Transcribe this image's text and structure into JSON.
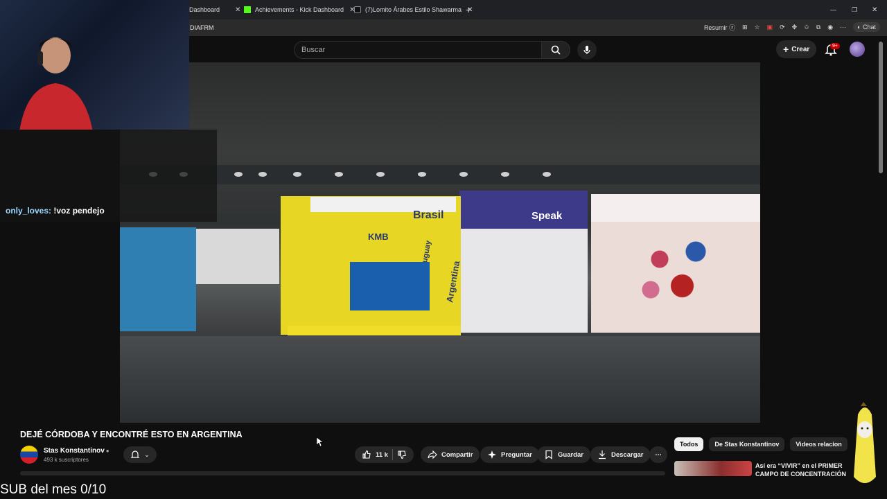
{
  "browser": {
    "tabs": [
      {
        "title": "Dashboard",
        "icon": "page-icon"
      },
      {
        "title": "Achievements - Kick Dashboard",
        "icon": "kick-icon"
      },
      {
        "title": "(7)Lomito Árabes Estilo Shawarma",
        "icon": "tiktok-icon"
      }
    ],
    "url_fragment": "DIAFRM",
    "summary_button": "Resumir",
    "chat_button": "Chat"
  },
  "youtube": {
    "search_placeholder": "Buscar",
    "create_label": "Crear",
    "notifications_badge": "9+"
  },
  "video": {
    "title": "DEJÉ CÓRDOBA Y ENCONTRÉ ESTO EN ARGENTINA",
    "channel_name": "Stas Konstantinov",
    "subscribers": "493 k suscriptores",
    "likes": "11 k",
    "actions": {
      "share": "Compartir",
      "ask": "Preguntar",
      "save": "Guardar",
      "download": "Descargar"
    },
    "scene_text": {
      "brand": "KMB",
      "country1": "Brasil",
      "country2": "Uruguay",
      "country3": "Argentina",
      "store": "Speak"
    }
  },
  "sidebar": {
    "chips": [
      "Todos",
      "De Stas Konstantinov",
      "Videos relacion"
    ],
    "recommendation_title": "Así era “VIVIR” en el PRIMER CAMPO DE CONCENTRACIÓN"
  },
  "stream_overlay": {
    "chat_user": "only_loves:",
    "chat_message": "!voz pendejo",
    "sub_goal": "SUB del mes 0/10"
  }
}
